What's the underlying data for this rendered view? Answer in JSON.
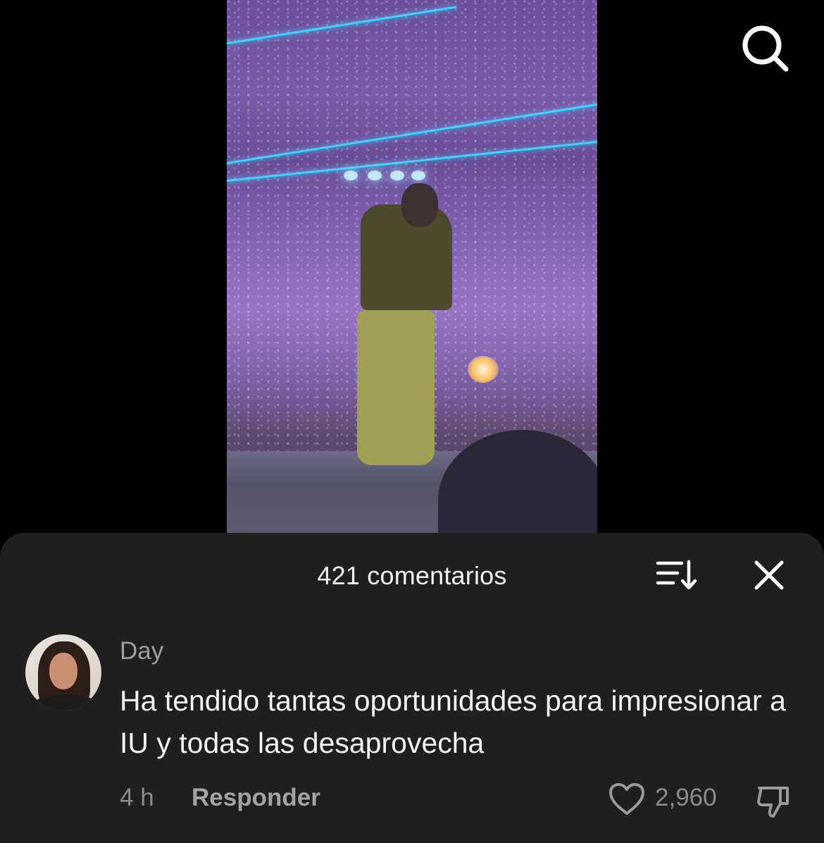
{
  "header": {
    "search_icon": "search-icon"
  },
  "video": {
    "description_icon": "concert-video"
  },
  "comments_sheet": {
    "title": "421 comentarios",
    "sort_icon": "sort-icon",
    "close_icon": "close-icon"
  },
  "comment": {
    "username": "Day",
    "text": "Ha tendido tantas oportunidades para impresionar a IU y todas las desaprovecha",
    "time": "4 h",
    "reply_label": "Responder",
    "like_count": "2,960",
    "like_icon": "heart-icon",
    "dislike_icon": "thumbs-down-icon"
  },
  "colors": {
    "sheet_bg": "#1f1f1f",
    "background": "#000000",
    "text_primary": "#f4f4f4",
    "text_secondary": "#8c8c8c"
  }
}
